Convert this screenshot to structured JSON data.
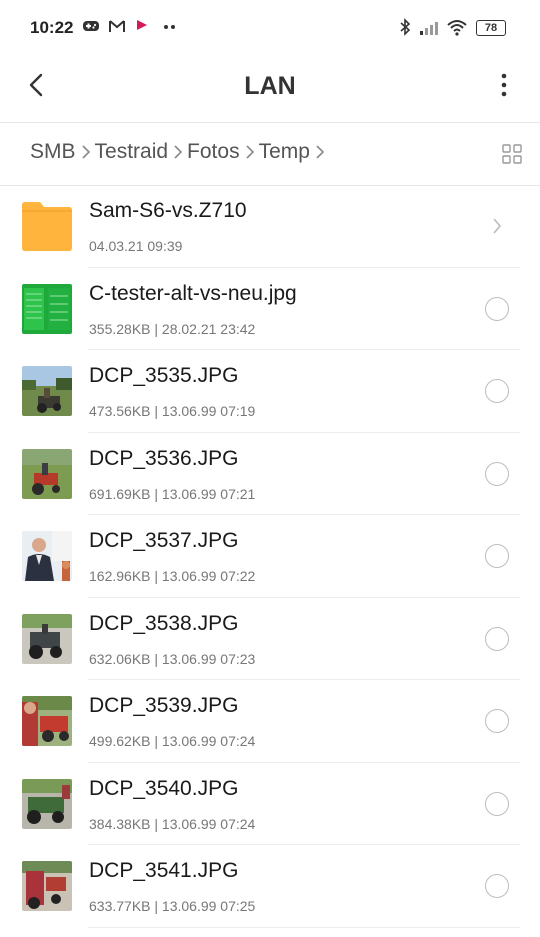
{
  "status_bar": {
    "time": "10:22",
    "icons": [
      "gamepad-icon",
      "gmail-icon",
      "flag-icon",
      "more-dots-icon"
    ],
    "right_icons": [
      "bluetooth-icon",
      "signal-icon",
      "wifi-icon",
      "battery-icon"
    ],
    "battery": "78"
  },
  "app_bar": {
    "title": "LAN"
  },
  "breadcrumb": {
    "items": [
      "SMB",
      "Testraid",
      "Fotos",
      "Temp"
    ]
  },
  "files": [
    {
      "name": "Sam-S6-vs.Z710",
      "meta": "04.03.21 09:39",
      "type": "folder"
    },
    {
      "name": "C-tester-alt-vs-neu.jpg",
      "meta": "355.28KB | 28.02.21 23:42",
      "type": "image"
    },
    {
      "name": "DCP_3535.JPG",
      "meta": "473.56KB | 13.06.99 07:19",
      "type": "image"
    },
    {
      "name": "DCP_3536.JPG",
      "meta": "691.69KB | 13.06.99 07:21",
      "type": "image"
    },
    {
      "name": "DCP_3537.JPG",
      "meta": "162.96KB | 13.06.99 07:22",
      "type": "image"
    },
    {
      "name": "DCP_3538.JPG",
      "meta": "632.06KB | 13.06.99 07:23",
      "type": "image"
    },
    {
      "name": "DCP_3539.JPG",
      "meta": "499.62KB | 13.06.99 07:24",
      "type": "image"
    },
    {
      "name": "DCP_3540.JPG",
      "meta": "384.38KB | 13.06.99 07:24",
      "type": "image"
    },
    {
      "name": "DCP_3541.JPG",
      "meta": "633.77KB | 13.06.99 07:25",
      "type": "image"
    }
  ],
  "colors": {
    "folder": "#FFB53D",
    "accent_flag": "#D6185C"
  }
}
